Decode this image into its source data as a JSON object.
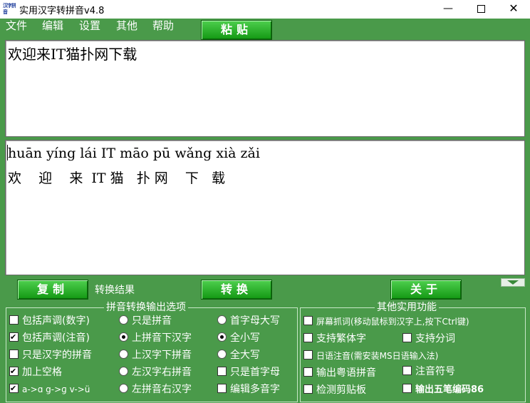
{
  "window": {
    "title": "实用汉字转拼音v4.8",
    "icon_text": "汉字拼音",
    "min_glyph": "—",
    "close_glyph": "✕"
  },
  "menu": {
    "items": [
      "文件",
      "编辑",
      "设置",
      "其他",
      "帮助"
    ]
  },
  "buttons": {
    "paste": "粘贴",
    "copy": "复制",
    "convert": "转换",
    "about": "关于"
  },
  "input": {
    "text": "欢迎来IT猫扑网下载"
  },
  "output": {
    "pinyin_line": "huān yíng lái IT māo pū wǎng xià zǎi",
    "hanzi_line": "欢    迎    来  IT 猫   扑 网    下   载"
  },
  "result_label": "转换结果",
  "pinyin_options": {
    "title": "拼音转换输出选项",
    "col1": [
      {
        "label": "包括声调(数字)",
        "checked": false
      },
      {
        "label": "包括声调(注音)",
        "checked": true
      },
      {
        "label": "只是汉字的拼音",
        "checked": false
      },
      {
        "label": "加上空格",
        "checked": true
      },
      {
        "label": "a->ɑ g->ɡ v->ü",
        "checked": true
      }
    ],
    "col2": [
      {
        "label": "只是拼音",
        "selected": false
      },
      {
        "label": "上拼音下汉字",
        "selected": true
      },
      {
        "label": "上汉字下拼音",
        "selected": false
      },
      {
        "label": "左汉字右拼音",
        "selected": false
      },
      {
        "label": "左拼音右汉字",
        "selected": false
      }
    ],
    "col3": [
      {
        "label": "首字母大写",
        "kind": "radio",
        "selected": false
      },
      {
        "label": "全小写",
        "kind": "radio",
        "selected": true
      },
      {
        "label": "全大写",
        "kind": "radio",
        "selected": false
      },
      {
        "label": "只是首字母",
        "kind": "checkbox",
        "checked": false
      },
      {
        "label": "编辑多音字",
        "kind": "checkbox",
        "checked": false
      }
    ]
  },
  "other_functions": {
    "title": "其他实用功能",
    "screen_capture": "屏幕抓词(移动鼠标到汉字上,按下Ctrl键)",
    "traditional": "支持繁体字",
    "segmentation": "支持分词",
    "japanese": "日语注音(需安装MS日语输入法)",
    "cantonese": "输出粤语拼音",
    "zhuyin": "注音符号",
    "clipboard": "检测剪贴板",
    "wubi": "输出五笔编码86"
  }
}
